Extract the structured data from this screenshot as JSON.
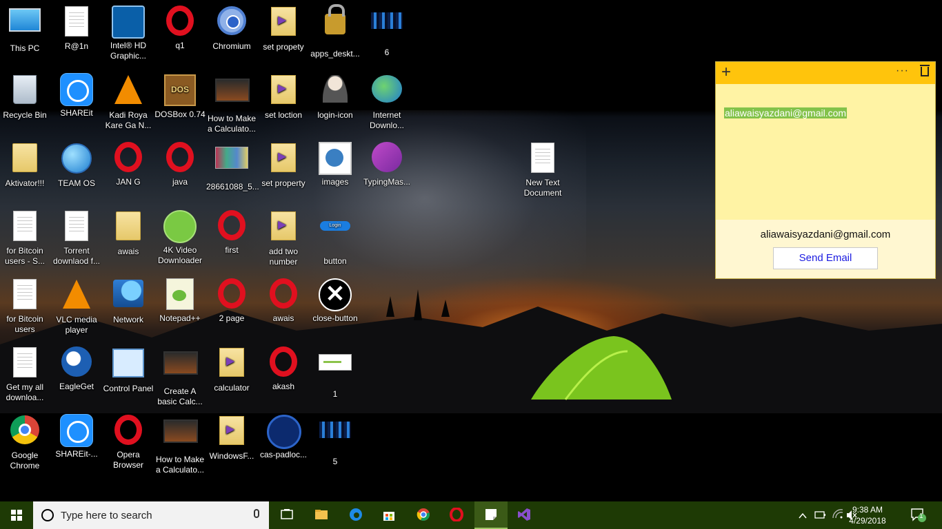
{
  "desktop": {
    "icons": [
      {
        "label": "This PC",
        "glyph": "pc-icon"
      },
      {
        "label": "R@1n",
        "glyph": "document-icon"
      },
      {
        "label": "Intel® HD Graphic...",
        "glyph": "intel-graphics-icon"
      },
      {
        "label": "q1",
        "glyph": "opera-icon"
      },
      {
        "label": "Chromium",
        "glyph": "chromium-icon"
      },
      {
        "label": "set propety",
        "glyph": "vs-project-folder-icon"
      },
      {
        "label": "apps_deskt...",
        "glyph": "padlock-icon"
      },
      {
        "label": "6",
        "glyph": "pixel-image-icon"
      },
      {
        "label": "Recycle Bin",
        "glyph": "recycle-bin-icon"
      },
      {
        "label": "SHAREit",
        "glyph": "shareit-icon"
      },
      {
        "label": "Kadi Roya Kare Ga N...",
        "glyph": "vlc-icon"
      },
      {
        "label": "DOSBox 0.74",
        "glyph": "dosbox-icon"
      },
      {
        "label": "How to Make a Calculato...",
        "glyph": "video-icon"
      },
      {
        "label": "set loction",
        "glyph": "vs-project-folder-icon"
      },
      {
        "label": "login-icon",
        "glyph": "login-user-icon"
      },
      {
        "label": "Internet Downlo...",
        "glyph": "idm-icon"
      },
      {
        "label": "Aktivator!!!",
        "glyph": "folder-icon"
      },
      {
        "label": "TEAM OS",
        "glyph": "globe-icon"
      },
      {
        "label": "JAN G",
        "glyph": "opera-icon"
      },
      {
        "label": "java",
        "glyph": "opera-icon"
      },
      {
        "label": "28661088_5...",
        "glyph": "photo-icon"
      },
      {
        "label": "set property",
        "glyph": "vs-project-folder-icon"
      },
      {
        "label": "images",
        "glyph": "login-image-icon"
      },
      {
        "label": "TypingMas...",
        "glyph": "typingmaster-icon"
      },
      {
        "label": "for Bitcoin users - S...",
        "glyph": "document-icon"
      },
      {
        "label": "Torrent downlaod f...",
        "glyph": "document-icon"
      },
      {
        "label": "awais",
        "glyph": "user-folder-icon"
      },
      {
        "label": "4K Video Downloader",
        "glyph": "4k-video-icon"
      },
      {
        "label": "first",
        "glyph": "opera-icon"
      },
      {
        "label": "add two number",
        "glyph": "vs-project-folder-icon"
      },
      {
        "label": "button",
        "glyph": "login-button-icon"
      },
      {
        "label": "for Bitcoin users",
        "glyph": "document-icon"
      },
      {
        "label": "VLC media player",
        "glyph": "vlc-icon"
      },
      {
        "label": "Network",
        "glyph": "network-icon"
      },
      {
        "label": "Notepad++",
        "glyph": "notepadpp-icon"
      },
      {
        "label": "2 page",
        "glyph": "opera-icon"
      },
      {
        "label": "awais",
        "glyph": "opera-icon"
      },
      {
        "label": "close-button",
        "glyph": "close-button-icon"
      },
      {
        "label": "Get my all downloa...",
        "glyph": "document-icon"
      },
      {
        "label": "EagleGet",
        "glyph": "eagleget-icon"
      },
      {
        "label": "Control Panel",
        "glyph": "control-panel-icon"
      },
      {
        "label": "Create A basic Calc...",
        "glyph": "video-icon"
      },
      {
        "label": "calculator",
        "glyph": "vs-project-folder-icon"
      },
      {
        "label": "akash",
        "glyph": "opera-icon"
      },
      {
        "label": "1",
        "glyph": "white-image-icon"
      },
      {
        "label": "Google Chrome",
        "glyph": "chrome-icon"
      },
      {
        "label": "SHAREit-...",
        "glyph": "shareit-icon"
      },
      {
        "label": "Opera Browser",
        "glyph": "opera-icon"
      },
      {
        "label": "How to Make a Calculato...",
        "glyph": "video-icon"
      },
      {
        "label": "WindowsF...",
        "glyph": "vs-project-folder-icon"
      },
      {
        "label": "cas-padloc...",
        "glyph": "cas-padlock-icon"
      },
      {
        "label": "5",
        "glyph": "pixel-image-icon"
      },
      {
        "label": "New Text Document",
        "glyph": "document-icon"
      }
    ]
  },
  "sticky_note": {
    "selected_text": "aliawaisyazdani@gmail.com",
    "detected_email": "aliawaisyazdani@gmail.com",
    "send_button": "Send Email",
    "add_glyph": "+",
    "menu_glyph": "···"
  },
  "taskbar": {
    "search_placeholder": "Type here to search",
    "apps": [
      "task-view-icon",
      "file-explorer-icon",
      "edge-icon",
      "store-icon",
      "chrome-icon",
      "opera-icon",
      "sticky-notes-icon",
      "visual-studio-icon"
    ],
    "active_app": "sticky-notes-icon",
    "time": "9:38 AM",
    "date": "4/29/2018",
    "notification_count": "1"
  }
}
